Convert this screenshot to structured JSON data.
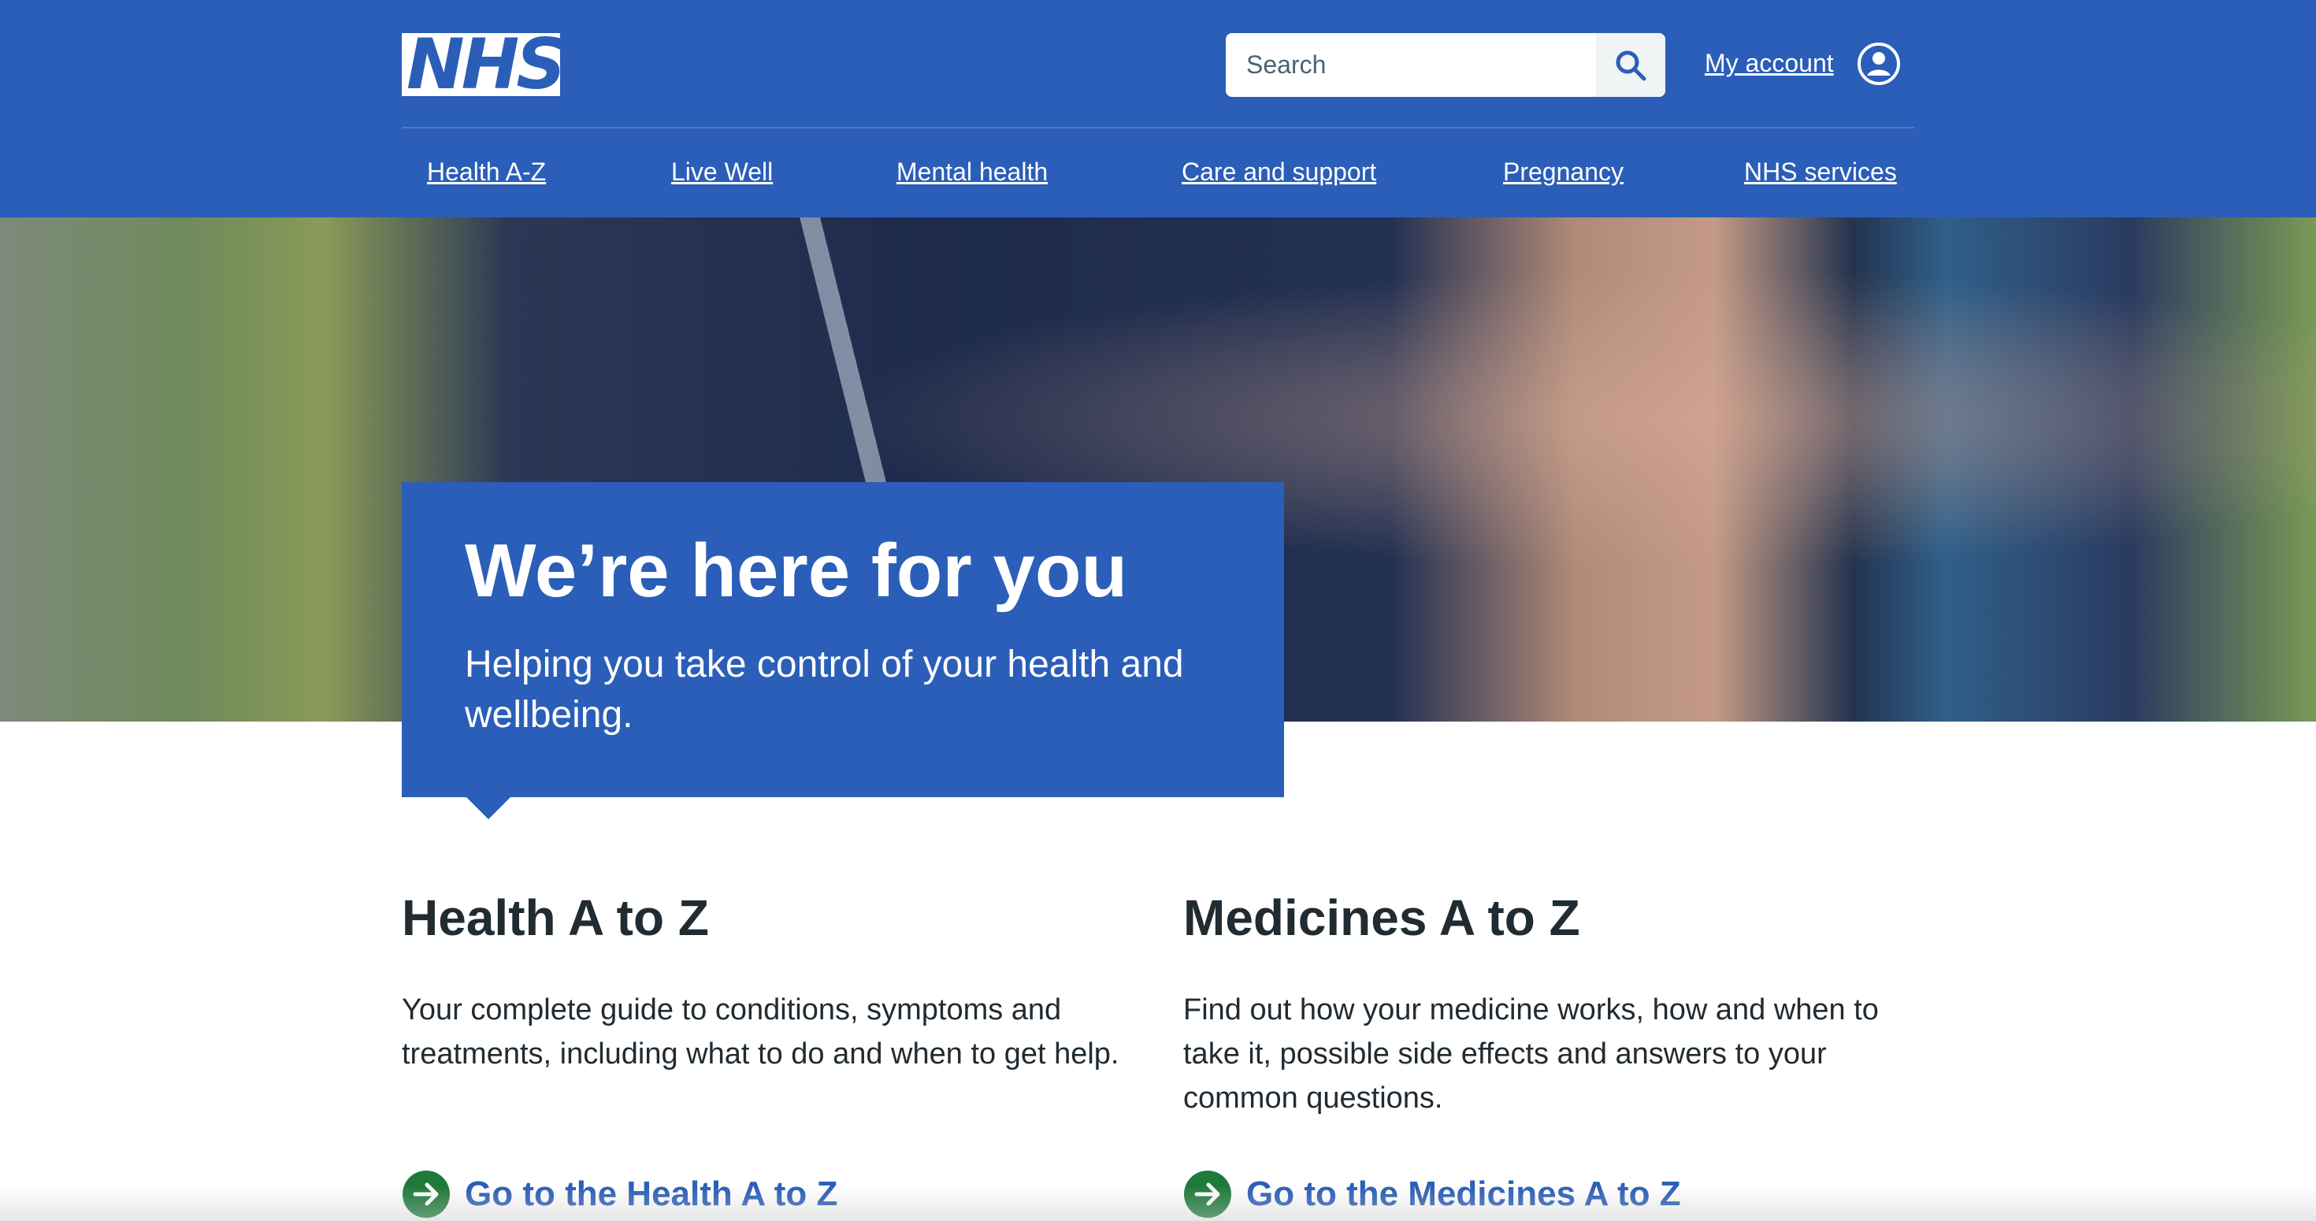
{
  "header": {
    "logo_text": "NHS",
    "search": {
      "placeholder": "Search"
    },
    "account_label": "My account"
  },
  "nav": [
    {
      "label": "Health A-Z"
    },
    {
      "label": "Live Well"
    },
    {
      "label": "Mental health"
    },
    {
      "label": "Care and support"
    },
    {
      "label": "Pregnancy"
    },
    {
      "label": "NHS services"
    }
  ],
  "hero": {
    "title": "We’re here for you",
    "subtitle": "Helping you take control of your health and wellbeing."
  },
  "sections": [
    {
      "title": "Health A to Z",
      "text": "Your complete guide to conditions, symptoms and treatments, including what to do and when to get help.",
      "link": "Go to the Health A to Z"
    },
    {
      "title": "Medicines A to Z",
      "text": "Find out how your medicine works, how and when to take it, possible side effects and answers to your common questions.",
      "link": "Go to the Medicines A to Z"
    }
  ],
  "colors": {
    "brand_blue": "#2a5eb8",
    "link_green": "#1e7a3a",
    "text": "#212b32"
  },
  "icons": [
    "search-icon",
    "user-circle-icon",
    "arrow-right-circle-icon"
  ]
}
